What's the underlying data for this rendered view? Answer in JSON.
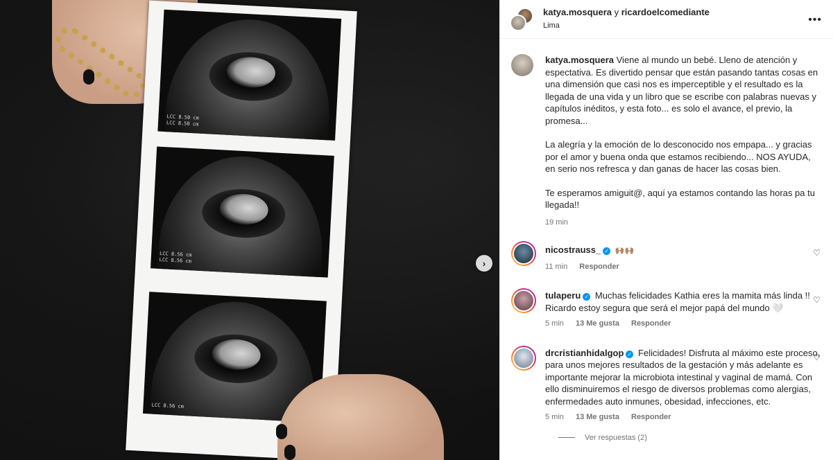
{
  "header": {
    "user1": "katya.mosquera",
    "connector": "y",
    "user2": "ricardoelcomediante",
    "location": "Lima",
    "more_label": "•••"
  },
  "media": {
    "frame_labels": [
      "LCC 8.50 cm\nLCC 8.50 cm",
      "LCC 8.56 cm\nLCC 8.56 cm",
      "LCC 8.56 cm"
    ],
    "next_label": "›"
  },
  "caption": {
    "username": "katya.mosquera",
    "p1": "Viene al mundo un bebé. Lleno de atención y espectativa. Es divertido pensar que están pasando tantas cosas en una dimensión que casi nos es imperceptible y el resultado es la llegada de una vida y un libro que se escribe con palabras nuevas y capítulos inéditos, y esta foto... es solo el avance, el previo, la promesa...",
    "p2": "La alegría y la emoción de lo desconocido nos empapa... y gracias por el amor y buena onda que estamos recibiendo... NOS AYUDA, en serio nos refresca y dan ganas de hacer las cosas bien.",
    "p3": "Te esperamos amiguit@, aquí ya estamos contando las horas pa tu llegada!!",
    "time": "19 min"
  },
  "comments": [
    {
      "username": "nicostrauss_",
      "text": "🙌🏽🙌🏽",
      "time": "11 min",
      "likes": "",
      "reply": "Responder"
    },
    {
      "username": "tulaperu",
      "text": "Muchas felicidades Kathia eres la mamita más linda !! Ricardo estoy segura que será el mejor papá del mundo 🤍",
      "time": "5 min",
      "likes": "13 Me gusta",
      "reply": "Responder"
    },
    {
      "username": "drcristianhidalgop",
      "text": "Felicidades! Disfruta al máximo este proceso, para unos mejores resultados de la gestación y más adelante es importante mejorar la microbiota intestinal y vaginal de mamá. Con ello disminuiremos el riesgo de diversos problemas como alergias, enfermedades auto inmunes, obesidad, infecciones, etc.",
      "time": "5 min",
      "likes": "13 Me gusta",
      "reply": "Responder"
    }
  ],
  "view_replies": "Ver respuestas (2)",
  "icons": {
    "verified": "verified-badge-icon",
    "heart": "heart-outline-icon",
    "next": "chevron-right-icon",
    "more": "more-dots-icon"
  },
  "colors": {
    "verified_blue": "#0095f6",
    "secondary_text": "#737373"
  }
}
